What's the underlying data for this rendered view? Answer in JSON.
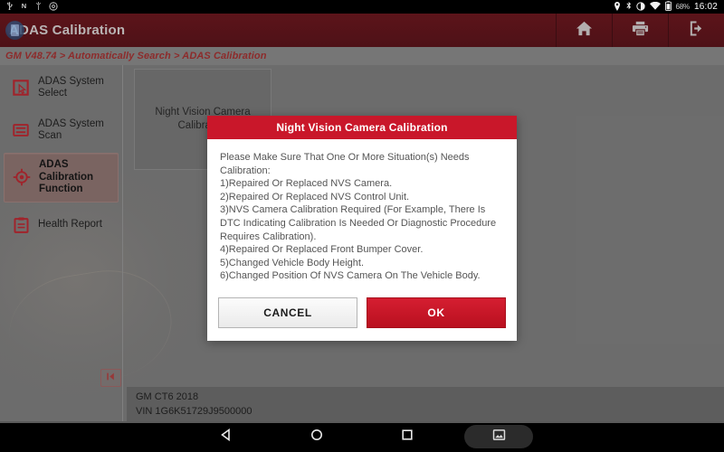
{
  "status_bar": {
    "icons_left": [
      "usb-icon",
      "network-n-icon",
      "usb-debug-icon",
      "settings-gear-icon"
    ],
    "location_icon": "location-pin-icon",
    "bluetooth_icon": "bluetooth-icon",
    "brightness_icon": "brightness-icon",
    "wifi_icon": "wifi-icon",
    "battery_icon": "battery-icon",
    "battery_percent": "68%",
    "time": "16:02"
  },
  "app_bar": {
    "title": "ADAS Calibration",
    "logo_icon": "adas-app-logo-icon",
    "actions": [
      {
        "name": "home-button",
        "icon": "home-icon"
      },
      {
        "name": "print-button",
        "icon": "printer-icon"
      },
      {
        "name": "exit-button",
        "icon": "exit-door-icon"
      }
    ]
  },
  "breadcrumb": {
    "text": "GM V48.74 > Automatically Search > ADAS Calibration"
  },
  "sidebar": {
    "items": [
      {
        "label": "ADAS System Select",
        "icon": "cursor-select-icon",
        "active": false
      },
      {
        "label": "ADAS System Scan",
        "icon": "scan-list-icon",
        "active": false
      },
      {
        "label": "ADAS Calibration Function",
        "icon": "target-crosshair-icon",
        "active": true
      },
      {
        "label": "Health Report",
        "icon": "clipboard-report-icon",
        "active": false
      }
    ],
    "collapse_button": {
      "name": "collapse-sidebar-button",
      "icon": "chevron-left-bar-icon"
    }
  },
  "main": {
    "card": {
      "label": "Night Vision Camera Calibration"
    }
  },
  "vehicle_info": {
    "line1": "GM CT6 2018",
    "line2": "VIN 1G6K51729J9500000"
  },
  "dialog": {
    "title": "Night Vision Camera Calibration",
    "body": "Please Make Sure That One Or More Situation(s) Needs Calibration:\n1)Repaired Or Replaced NVS Camera.\n2)Repaired Or Replaced NVS Control Unit.\n3)NVS Camera Calibration Required (For Example, There Is DTC Indicating Calibration Is Needed Or Diagnostic Procedure Requires Calibration).\n4)Repaired Or Replaced Front Bumper Cover.\n5)Changed Vehicle Body Height.\n6)Changed Position Of NVS Camera On The Vehicle Body.",
    "cancel_label": "CANCEL",
    "ok_label": "OK"
  },
  "nav_bar": {
    "back": "back-triangle-icon",
    "home": "home-circle-icon",
    "recents": "recents-square-icon",
    "screenshot": "screenshot-image-icon"
  },
  "colors": {
    "brand_red": "#c9172a",
    "appbar_maroon": "#4e1117",
    "content_gray": "#6f6f6f",
    "breadcrumb_gray": "#767676",
    "icon_red": "#a4242c"
  }
}
